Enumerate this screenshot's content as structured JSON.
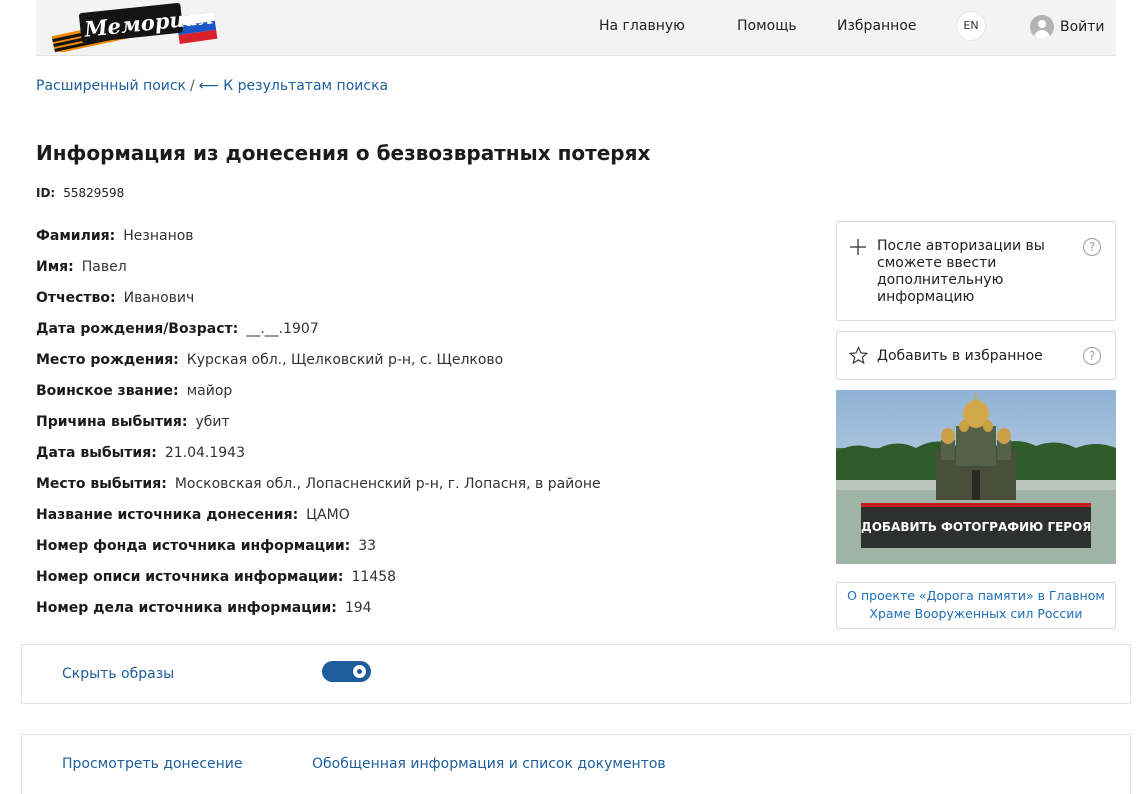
{
  "header": {
    "logo_text": "Мемориал",
    "nav": [
      "На главную",
      "Помощь",
      "Избранное"
    ],
    "lang": "EN",
    "login": "Войти"
  },
  "breadcrumb": {
    "search": "Расширенный поиск",
    "separator": "/",
    "back": "⟵ К результатам поиска"
  },
  "page": {
    "title": "Информация из донесения о безвозвратных потерях",
    "id_label": "ID:",
    "id_value": "55829598"
  },
  "fields": [
    {
      "label": "Фамилия:",
      "value": "Незнанов"
    },
    {
      "label": "Имя:",
      "value": "Павел"
    },
    {
      "label": "Отчество:",
      "value": "Иванович"
    },
    {
      "label": "Дата рождения/Возраст:",
      "value": "__.__.1907"
    },
    {
      "label": "Место рождения:",
      "value": "Курская обл., Щелковский р-н, с. Щелково"
    },
    {
      "label": "Воинское звание:",
      "value": "майор"
    },
    {
      "label": "Причина выбытия:",
      "value": "убит"
    },
    {
      "label": "Дата выбытия:",
      "value": "21.04.1943"
    },
    {
      "label": "Место выбытия:",
      "value": "Московская обл., Лопасненский р-н, г. Лопасня, в районе"
    },
    {
      "label": "Название источника донесения:",
      "value": "ЦАМО"
    },
    {
      "label": "Номер фонда источника информации:",
      "value": "33"
    },
    {
      "label": "Номер описи источника информации:",
      "value": "11458"
    },
    {
      "label": "Номер дела источника информации:",
      "value": "194"
    }
  ],
  "sidebar": {
    "auth_text": "После авторизации вы сможете ввести дополнительную информацию",
    "fav_text": "Добавить в избранное",
    "help_glyph": "?",
    "photo_button": "ДОБАВИТЬ ФОТОГРАФИЮ ГЕРОЯ",
    "about_link": "О проекте «Дорога памяти» в Главном Храме Вооруженных сил России"
  },
  "toggle": {
    "label": "Скрыть образы",
    "on": true
  },
  "bottom_links": [
    "Просмотреть донесение",
    "Обобщенная информация и список документов"
  ],
  "colors": {
    "link": "#1d5e9c",
    "toggle": "#1f5c9e",
    "accent_red": "#c31f1f"
  },
  "icons": {
    "plus": "plus-icon",
    "star": "star-icon",
    "help": "question-icon",
    "user": "user-icon"
  }
}
